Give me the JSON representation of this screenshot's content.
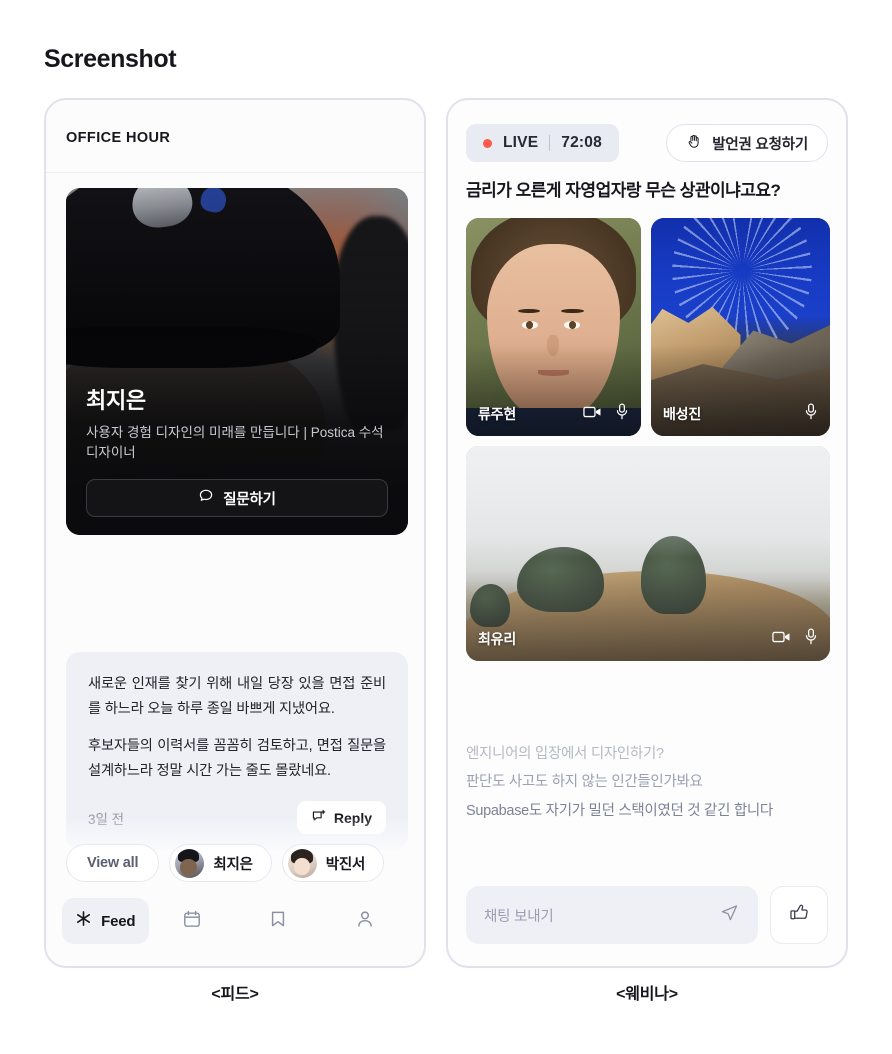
{
  "page": {
    "heading": "Screenshot"
  },
  "captions": {
    "left": "<피드>",
    "right": "<웨비나>"
  },
  "feed_panel": {
    "section_title": "OFFICE HOUR",
    "hero": {
      "name": "최지은",
      "bio": "사용자 경험 디자인의 미래를 만듭니다 | Postica 수석 디자이너",
      "ask_button_label": "질문하기",
      "ask_button_icon": "speech-bubble-icon"
    },
    "comments": [
      {
        "paragraphs": [
          "새로운 인재를 찾기 위해 내일 당장 있을 면접 준비를 하느라 오늘 하루 종일 바쁘게 지냈어요.",
          "후보자들의 이력서를 꼼꼼히 검토하고, 면접 질문을 설계하느라 정말 시간 가는 줄도 몰랐네요."
        ],
        "time": "3일 전",
        "reply_label": "Reply",
        "reply_icon": "reply-bubble-icon"
      },
      {
        "paragraphs": [
          "새로운 인재를 찾기 위해 내일 당장 있을 면접 준"
        ]
      }
    ],
    "chips": [
      {
        "label": "View all",
        "avatar": null
      },
      {
        "label": "최지은",
        "avatar": "avatar-choi-jieun"
      },
      {
        "label": "박진서",
        "avatar": "avatar-park-jinseo"
      }
    ],
    "nav": [
      {
        "label": "Feed",
        "icon": "asterisk-icon",
        "active": true
      },
      {
        "label": "",
        "icon": "calendar-icon",
        "active": false
      },
      {
        "label": "",
        "icon": "bookmark-icon",
        "active": false
      },
      {
        "label": "",
        "icon": "person-icon",
        "active": false
      }
    ]
  },
  "webinar_panel": {
    "live_label": "LIVE",
    "timer": "72:08",
    "request_button_label": "발언권 요청하기",
    "request_button_icon": "raised-hand-icon",
    "title": "금리가 오른게 자영업자랑 무슨 상관이냐고요?",
    "tiles": [
      {
        "name": "류주현",
        "camera": true,
        "mic": true,
        "media": "portrait-photo"
      },
      {
        "name": "배성진",
        "camera": false,
        "mic": true,
        "media": "star-trails-photo"
      },
      {
        "name": "최유리",
        "camera": true,
        "mic": true,
        "media": "foggy-hill-photo"
      }
    ],
    "chat_messages": [
      "엔지니어의 입장에서 디자인하기?",
      "판단도 사고도 하지 않는 인간들인가봐요",
      "Supabase도 자기가 밀던 스택이였던 것 같긴 합니다"
    ],
    "chat_input_placeholder": "채팅 보내기",
    "send_icon": "send-icon",
    "like_icon": "thumbs-up-icon"
  },
  "colors": {
    "live_dot": "#fb5a4b",
    "panel_border": "#dfe1ed",
    "card_bg": "#eef0f6"
  }
}
